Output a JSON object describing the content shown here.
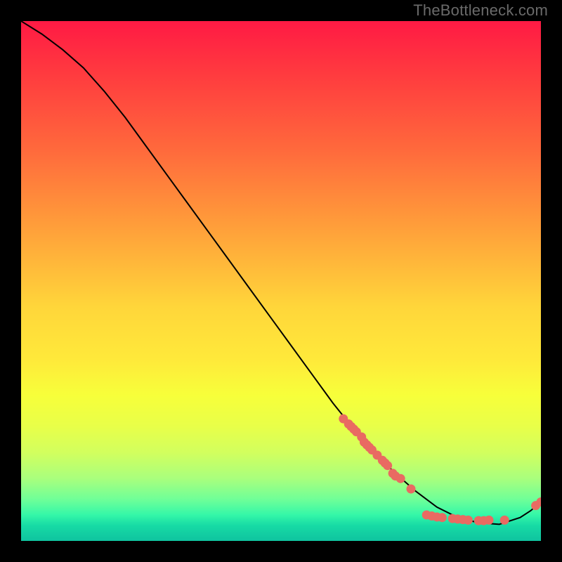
{
  "watermark": "TheBottleneck.com",
  "colors": {
    "curve": "#000000",
    "marker": "#e96a62",
    "markerStroke": "#e96a62"
  },
  "chart_data": {
    "type": "line",
    "title": "",
    "xlabel": "",
    "ylabel": "",
    "xlim": [
      0,
      100
    ],
    "ylim": [
      0,
      100
    ],
    "legend": false,
    "grid": false,
    "series": [
      {
        "name": "curve",
        "x": [
          0,
          4,
          8,
          12,
          16,
          20,
          24,
          28,
          32,
          36,
          40,
          44,
          48,
          52,
          56,
          60,
          64,
          68,
          72,
          76,
          80,
          84,
          88,
          92,
          96,
          98,
          100
        ],
        "y": [
          100,
          97.5,
          94.5,
          91,
          86.5,
          81.5,
          76,
          70.5,
          65,
          59.5,
          54,
          48.5,
          43,
          37.5,
          32,
          26.5,
          21.5,
          17,
          13,
          9.5,
          6.5,
          4.5,
          3.5,
          3.2,
          4.5,
          5.8,
          7.5
        ]
      }
    ],
    "markers": [
      {
        "x": 62,
        "y": 23.5
      },
      {
        "x": 63,
        "y": 22.5
      },
      {
        "x": 63.5,
        "y": 22
      },
      {
        "x": 64,
        "y": 21.5
      },
      {
        "x": 64.5,
        "y": 21
      },
      {
        "x": 65.5,
        "y": 20
      },
      {
        "x": 66,
        "y": 19
      },
      {
        "x": 66.5,
        "y": 18.5
      },
      {
        "x": 67,
        "y": 18
      },
      {
        "x": 67.5,
        "y": 17.5
      },
      {
        "x": 68.5,
        "y": 16.5
      },
      {
        "x": 69.5,
        "y": 15.5
      },
      {
        "x": 70,
        "y": 15
      },
      {
        "x": 70.5,
        "y": 14.5
      },
      {
        "x": 71.5,
        "y": 13
      },
      {
        "x": 72,
        "y": 12.5
      },
      {
        "x": 73,
        "y": 12
      },
      {
        "x": 75,
        "y": 10
      },
      {
        "x": 78,
        "y": 5.0
      },
      {
        "x": 79,
        "y": 4.8
      },
      {
        "x": 80,
        "y": 4.6
      },
      {
        "x": 81,
        "y": 4.5
      },
      {
        "x": 83,
        "y": 4.3
      },
      {
        "x": 84,
        "y": 4.2
      },
      {
        "x": 85,
        "y": 4.1
      },
      {
        "x": 86,
        "y": 4.0
      },
      {
        "x": 88,
        "y": 3.9
      },
      {
        "x": 89,
        "y": 3.9
      },
      {
        "x": 90,
        "y": 4.0
      },
      {
        "x": 93,
        "y": 4.0
      },
      {
        "x": 99,
        "y": 6.8
      },
      {
        "x": 100,
        "y": 7.5
      }
    ],
    "marker_radius": 6
  }
}
